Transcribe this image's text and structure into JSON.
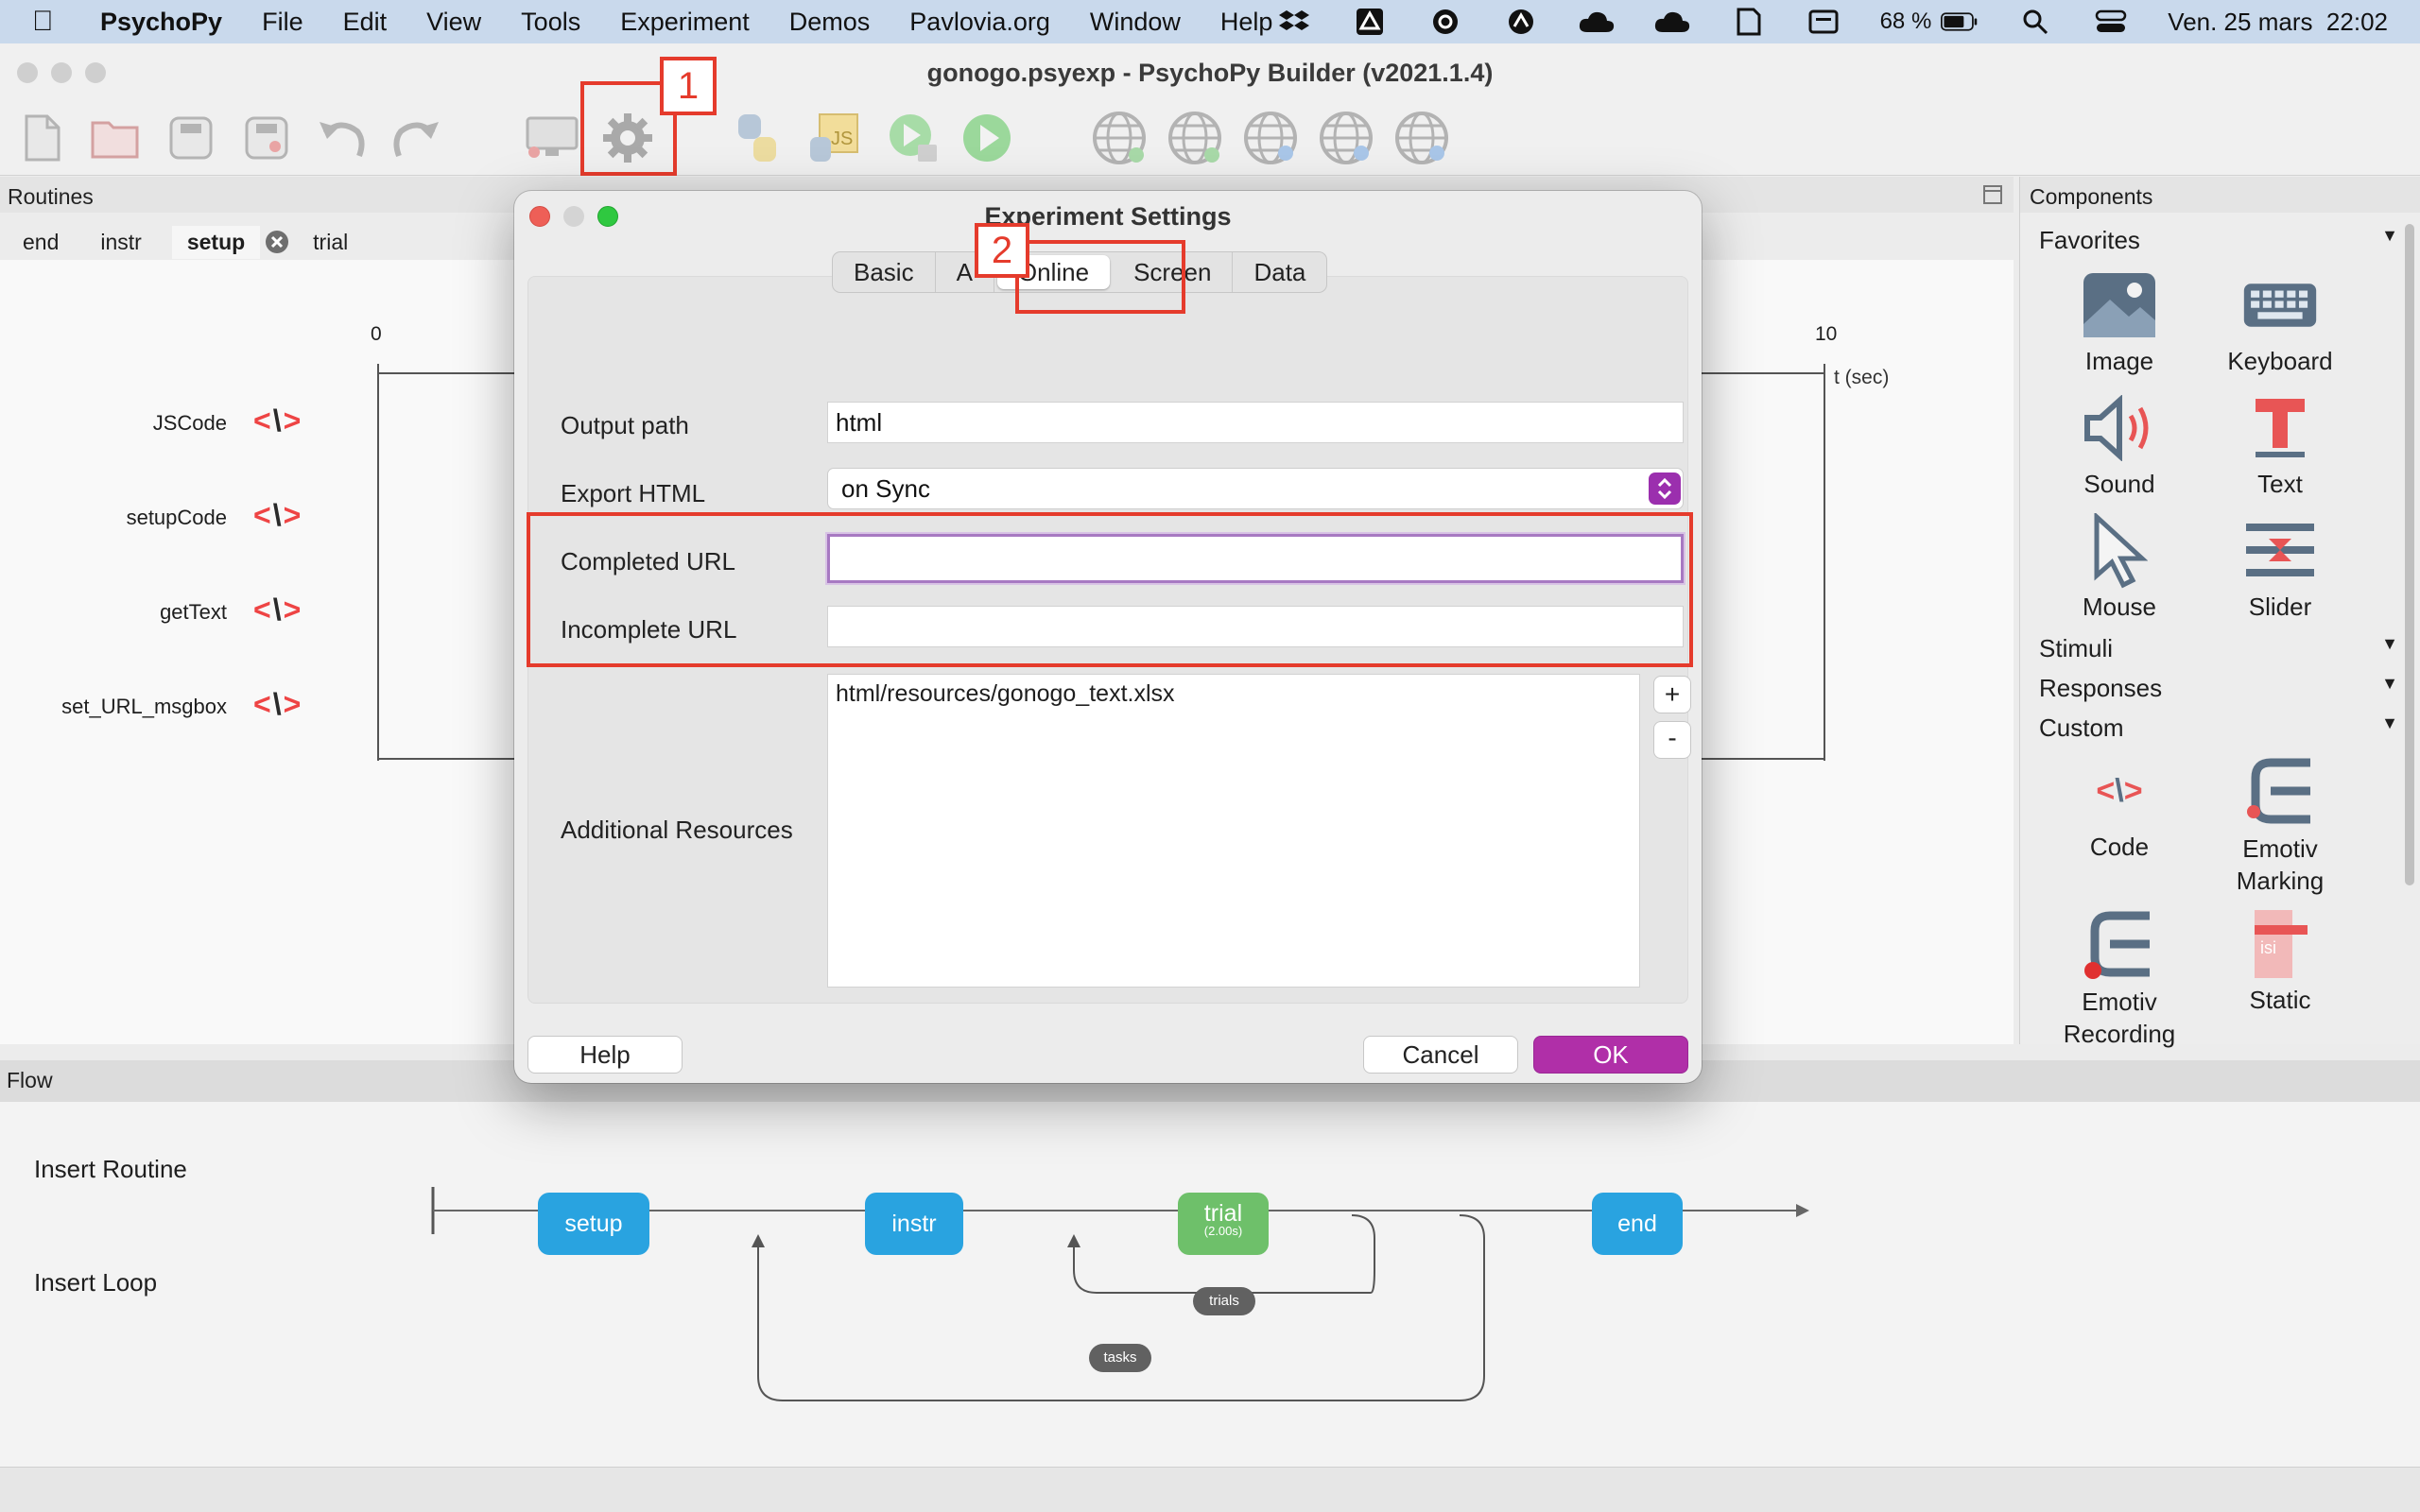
{
  "menubar": {
    "app_name": "PsychoPy",
    "items": [
      "File",
      "Edit",
      "View",
      "Tools",
      "Experiment",
      "Demos",
      "Pavlovia.org",
      "Window",
      "Help"
    ],
    "battery": "68 %",
    "datetime": "Ven. 25 mars  22:02"
  },
  "window": {
    "title": "gonogo.psyexp - PsychoPy Builder (v2021.1.4)"
  },
  "annotations": {
    "one": "1",
    "two": "2"
  },
  "routines": {
    "header": "Routines",
    "tabs": [
      "end",
      "instr",
      "setup",
      "trial"
    ],
    "active_tab": "setup",
    "axis_start": "0",
    "axis_end": "10",
    "axis_unit": "t (sec)",
    "components": [
      "JSCode",
      "setupCode",
      "getText",
      "set_URL_msgbox"
    ]
  },
  "components_panel": {
    "header": "Components",
    "favorites": "Favorites",
    "items": [
      "Image",
      "Keyboard",
      "Sound",
      "Text",
      "Mouse",
      "Slider"
    ],
    "categories": [
      "Stimuli",
      "Responses",
      "Custom"
    ],
    "custom_items": [
      "Code",
      "Emotiv Marking",
      "Emotiv Recording",
      "Static"
    ]
  },
  "flow": {
    "header": "Flow",
    "insert_routine": "Insert Routine",
    "insert_loop": "Insert Loop",
    "routines": [
      "setup",
      "instr",
      "trial",
      "end"
    ],
    "trial_duration": "(2.00s)",
    "loops": [
      "trials",
      "tasks"
    ],
    "colors": {
      "routine": "#29a3e0",
      "trial": "#6ec06a",
      "loop": "#616161"
    }
  },
  "dialog": {
    "title": "Experiment Settings",
    "tabs": [
      "Basic",
      "A",
      "Online",
      "Screen",
      "Data"
    ],
    "selected_tab": "Online",
    "fields": {
      "output_path_label": "Output path",
      "output_path_value": "html",
      "export_html_label": "Export HTML",
      "export_html_value": "on Sync",
      "completed_url_label": "Completed URL",
      "completed_url_value": "",
      "incomplete_url_label": "Incomplete URL",
      "incomplete_url_value": "",
      "resources_label": "Additional Resources",
      "resources_items": [
        "html/resources/gonogo_text.xlsx"
      ]
    },
    "add_label": "+",
    "remove_label": "-",
    "help_label": "Help",
    "cancel_label": "Cancel",
    "ok_label": "OK",
    "ok_color": "#b02fa8"
  }
}
